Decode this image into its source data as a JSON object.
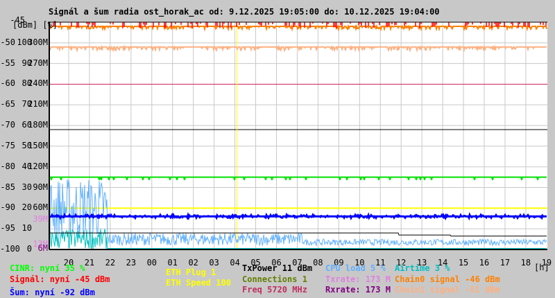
{
  "chart_data": {
    "type": "line",
    "title": "Signál a šum radia ost_horak_ac od: 9.12.2025 19:05:00 do: 10.12.2025 19:04:00",
    "y_unit_labels": "[dBm] [%]",
    "x_unit_label": "[h]",
    "x_ticks": [
      "20",
      "21",
      "22",
      "23",
      "00",
      "01",
      "02",
      "03",
      "04",
      "05",
      "06",
      "07",
      "08",
      "09",
      "10",
      "11",
      "12",
      "13",
      "14",
      "15",
      "16",
      "17",
      "18",
      "19"
    ],
    "y_ticks": [
      {
        "dbm": "-45",
        "pct": "",
        "rate": ""
      },
      {
        "dbm": "-50",
        "pct": "100",
        "rate": "300M"
      },
      {
        "dbm": "-55",
        "pct": "90",
        "rate": "270M"
      },
      {
        "dbm": "-60",
        "pct": "80",
        "rate": "240M"
      },
      {
        "dbm": "-65",
        "pct": "70",
        "rate": "210M"
      },
      {
        "dbm": "-70",
        "pct": "60",
        "rate": "180M"
      },
      {
        "dbm": "-75",
        "pct": "50",
        "rate": "150M"
      },
      {
        "dbm": "-80",
        "pct": "40",
        "rate": "120M"
      },
      {
        "dbm": "-85",
        "pct": "30",
        "rate": "90M"
      },
      {
        "dbm": "-90",
        "pct": "20",
        "rate": "60M"
      },
      {
        "dbm": "-95",
        "pct": "10",
        "rate": ""
      },
      {
        "dbm": "-100",
        "pct": "0",
        "rate": ""
      }
    ],
    "extra_rate_ticks": [
      {
        "label": "39M",
        "color": "#e080e0"
      },
      {
        "label": "13M",
        "color": "#e080e0"
      },
      {
        "label": "6M",
        "color": "#800080"
      }
    ],
    "ylim_dbm": [
      -100,
      -45
    ],
    "grid": true,
    "series": [
      {
        "name": "Signál",
        "color": "#ff0000",
        "level_dbm": -45
      },
      {
        "name": "Chain0 signal",
        "color": "#ff7f00",
        "level_dbm": -46
      },
      {
        "name": "Chain1 signal",
        "color": "#ffb080",
        "level_dbm": -51
      },
      {
        "name": "CINR",
        "color": "#00e000",
        "level_pct": 35
      },
      {
        "name": "Šum",
        "color": "#0000ff",
        "level_dbm": -92
      },
      {
        "name": "ETH Speed",
        "color": "#ffff00",
        "level_pct": 20
      },
      {
        "name": "TxPower",
        "color": "#000000",
        "level_dbm": -71
      },
      {
        "name": "CPU load",
        "color": "#60b0ff",
        "level_pct": 5
      },
      {
        "name": "Airtime",
        "color": "#00c0c0",
        "level_pct": 3
      },
      {
        "name": "Freq",
        "color": "#d02060",
        "level_dbm": -60
      },
      {
        "name": "Connections",
        "color": "#608000",
        "level_pct": 1
      }
    ],
    "marker_hour": "04"
  },
  "legend": [
    {
      "text": "CINR: nyní 35 %",
      "color": "#00ff00"
    },
    {
      "text": "Signál: nyní -45 dBm",
      "color": "#ff0000"
    },
    {
      "text": "Šum: nyní -92 dBm",
      "color": "#0000ff"
    },
    {
      "text": "ETH Plug 1",
      "color": "#ffff00"
    },
    {
      "text": "ETH Speed 100",
      "color": "#ffff00"
    },
    {
      "text": "TxPower 11 dBm",
      "color": "#000000"
    },
    {
      "text": "Connections 1",
      "color": "#608000"
    },
    {
      "text": "Freq 5720 MHz",
      "color": "#c03060"
    },
    {
      "text": "CPU load 5 %",
      "color": "#60b0ff"
    },
    {
      "text": "Txrate: 173 M",
      "color": "#e080e0"
    },
    {
      "text": "Rxrate: 173 M",
      "color": "#800080"
    },
    {
      "text": "Airtime 3 %",
      "color": "#00c0c0"
    },
    {
      "text": "Chain0 signal -46 dBm",
      "color": "#ff8000"
    },
    {
      "text": "Chain1 signal -51 dBm",
      "color": "#ffb080"
    }
  ]
}
